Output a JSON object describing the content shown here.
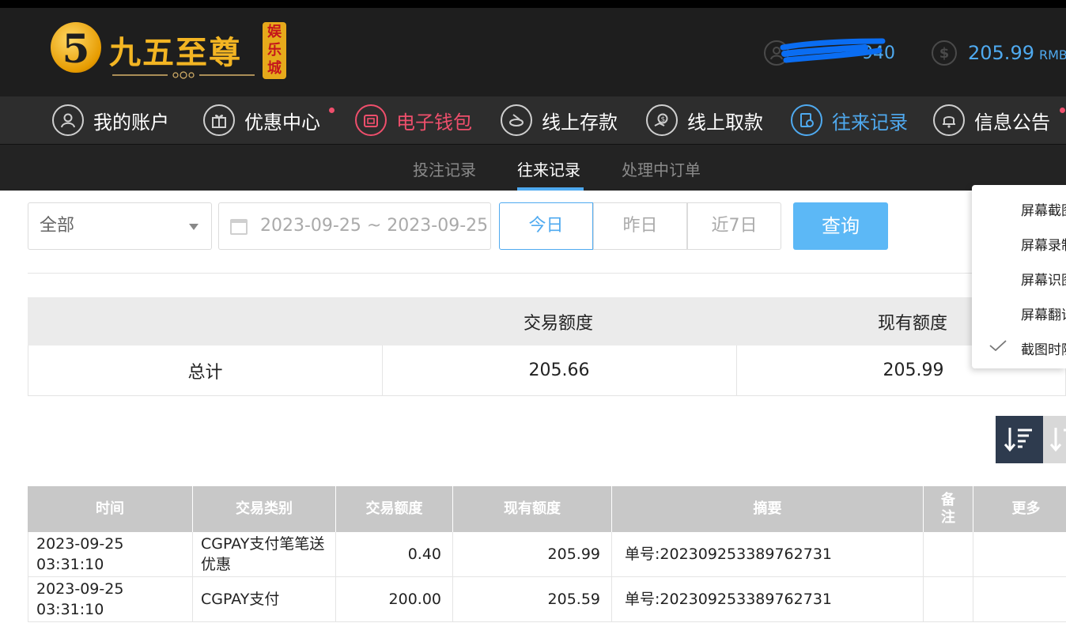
{
  "brand": {
    "logo_numeral": "5",
    "title": "九五至尊",
    "badge": [
      "娱",
      "乐",
      "城"
    ]
  },
  "user": {
    "username_visible": "940",
    "balance": "205.99",
    "currency": "RMB"
  },
  "nav": {
    "items": [
      {
        "label": "我的账户",
        "icon": "user-icon"
      },
      {
        "label": "优惠中心",
        "icon": "gift-icon",
        "dot": true
      },
      {
        "label": "电子钱包",
        "icon": "wallet-icon",
        "color": "#ef4f6c"
      },
      {
        "label": "线上存款",
        "icon": "deposit-icon"
      },
      {
        "label": "线上取款",
        "icon": "withdraw-icon"
      },
      {
        "label": "往来记录",
        "icon": "records-icon",
        "color": "#4faaf0",
        "active": true
      },
      {
        "label": "信息公告",
        "icon": "bell-icon",
        "dot": true
      }
    ]
  },
  "subnav": {
    "tabs": [
      {
        "label": "投注记录"
      },
      {
        "label": "往来记录",
        "active": true
      },
      {
        "label": "处理中订单"
      }
    ]
  },
  "filters": {
    "type_select": "全部",
    "date_range": "2023-09-25 ~ 2023-09-25",
    "day_buttons": [
      "今日",
      "昨日",
      "近7日"
    ],
    "active_day": "今日",
    "query_label": "查询"
  },
  "summary": {
    "headers": [
      "",
      "交易额度",
      "现有额度"
    ],
    "row": {
      "label": "总计",
      "amount": "205.66",
      "balance": "205.99"
    }
  },
  "records": {
    "headers": [
      "时间",
      "交易类别",
      "交易额度",
      "现有额度",
      "摘要",
      "备注",
      "更多"
    ],
    "rows": [
      {
        "time": "2023-09-25 03:31:10",
        "type": "CGPAY支付笔笔送优惠",
        "amount": "0.40",
        "balance": "205.99",
        "summary": "单号:202309253389762731",
        "note": "",
        "more": ""
      },
      {
        "time": "2023-09-25 03:31:10",
        "type": "CGPAY支付",
        "amount": "200.00",
        "balance": "205.59",
        "summary": "单号:202309253389762731",
        "note": "",
        "more": ""
      }
    ]
  },
  "context_menu": {
    "items": [
      {
        "label": "屏幕截图"
      },
      {
        "label": "屏幕录制"
      },
      {
        "label": "屏幕识图"
      },
      {
        "label": "屏幕翻译"
      },
      {
        "label": "截图时隐藏当前窗口",
        "checked": true
      }
    ]
  },
  "colors": {
    "accent_blue": "#4faaf0",
    "accent_red": "#ef4f6c",
    "header_bg": "#1e1e1e",
    "nav_bg": "#2d2d2d",
    "query_button": "#5cb8f6",
    "sort_active": "#2e3b4e"
  }
}
